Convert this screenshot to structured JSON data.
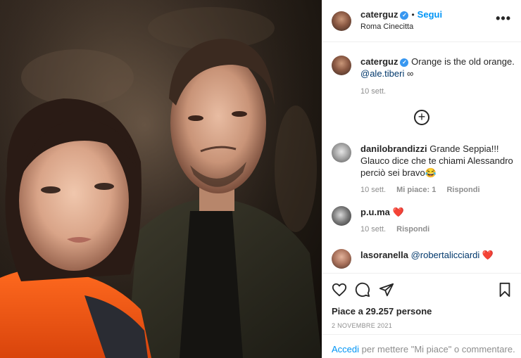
{
  "post": {
    "author": "caterguz",
    "follow_label": "Segui",
    "dot": "•",
    "location": "Roma Cinecitta",
    "more_icon": "more-horizontal-icon"
  },
  "caption": {
    "username": "caterguz",
    "text": "Orange is the old orange.",
    "mention": "@ale.tiberi",
    "glyph": "∞",
    "time": "10 sett."
  },
  "load_more_symbol": "+",
  "comments": [
    {
      "username": "danilobrandizzi",
      "text": "Grande Seppia!!! Glauco dice che te chiami Alessandro perciò sei bravo😂",
      "time": "10 sett.",
      "likes": "Mi piace: 1",
      "reply": "Rispondi"
    },
    {
      "username": "p.u.ma",
      "text": "❤️",
      "time": "10 sett.",
      "reply": "Rispondi"
    },
    {
      "username": "lasoranella",
      "mention": "@robertalicciardi",
      "text": "❤️"
    }
  ],
  "actions": {
    "icons": [
      "heart-icon",
      "comment-icon",
      "share-icon",
      "bookmark-icon"
    ],
    "likes_text": "Piace a 29.257 persone",
    "date": "2 NOVEMBRE 2021"
  },
  "login": {
    "link": "Accedi",
    "text": " per mettere \"Mi piace\" o commentare."
  },
  "colors": {
    "link_blue": "#0095f6",
    "verified_blue": "#3897f0",
    "heart_red": "#ed4956",
    "meta_gray": "#8e8e8e"
  }
}
